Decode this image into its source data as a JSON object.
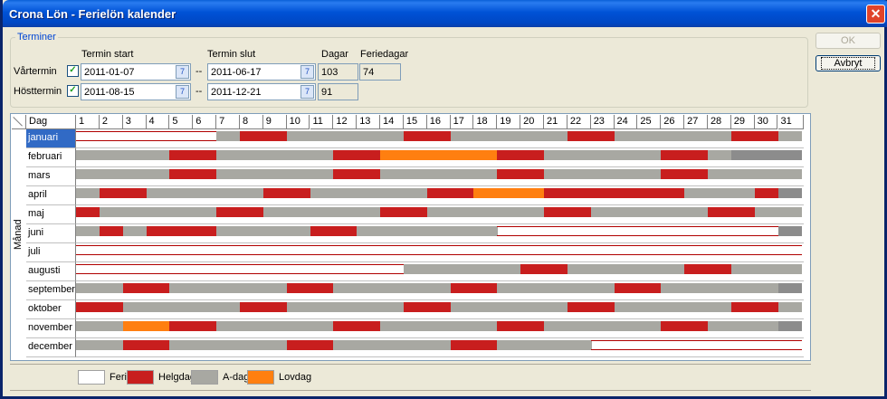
{
  "window": {
    "title": "Crona Lön - Ferielön kalender",
    "close_glyph": "✕"
  },
  "terminer": {
    "legend": "Terminer",
    "headers": {
      "start": "Termin start",
      "end": "Termin slut",
      "dagar": "Dagar",
      "feriedagar": "Feriedagar"
    },
    "spring": {
      "label": "Vårtermin",
      "checked": true,
      "start": "2011-01-07",
      "sep": "--",
      "end": "2011-06-17",
      "dagar": "103",
      "feriedagar": "74"
    },
    "autumn": {
      "label": "Hösttermin",
      "checked": true,
      "start": "2011-08-15",
      "sep": "--",
      "end": "2011-12-21",
      "dagar": "91",
      "feriedagar": ""
    }
  },
  "buttons": {
    "ok": "OK",
    "cancel": "Avbryt"
  },
  "calendar": {
    "day_header": "Dag",
    "axis_label": "Månad",
    "days": [
      "1",
      "2",
      "3",
      "4",
      "5",
      "6",
      "7",
      "8",
      "9",
      "10",
      "11",
      "12",
      "13",
      "14",
      "15",
      "16",
      "17",
      "18",
      "19",
      "20",
      "21",
      "22",
      "23",
      "24",
      "25",
      "26",
      "27",
      "28",
      "29",
      "30",
      "31"
    ],
    "colors": {
      "F": "#ffffff",
      "H": "#c81e1e",
      "A": "#a8a8a2",
      "L": "#ff7f10",
      "X": "#8c8c8c"
    },
    "months": [
      {
        "name": "januari",
        "pattern": "FFFFFFAHHAAAAAHHAAAAAHHAAAAAHHA"
      },
      {
        "name": "februari",
        "pattern": "AAAAHHAAAAAHHLLLLLHHAAAAAHHAXXX"
      },
      {
        "name": "mars",
        "pattern": "AAAAHHAAAAAHHAAAAAHHAAAAAHHAAAA"
      },
      {
        "name": "april",
        "pattern": "AHHAAAAAHHAAAAAHHLLLHHHHHHAAAHX"
      },
      {
        "name": "maj",
        "pattern": "HAAAAAHHAAAAAHHAAAAAHHAAAAAHHAA"
      },
      {
        "name": "juni",
        "pattern": "AHAHHHAAAAHHAAAAAAFFFFFFFFFFFFX"
      },
      {
        "name": "juli",
        "pattern": "FFFFFFFFFFFFFFFFFFFFFFFFFFFFFFF"
      },
      {
        "name": "augusti",
        "pattern": "FFFFFFFFFFFFFFAAAAAHHAAAAAHHAAA"
      },
      {
        "name": "september",
        "pattern": "AAHHAAAAAHHAAAAAHHAAAAAHHAAAAAX"
      },
      {
        "name": "oktober",
        "pattern": "HHAAAAAHHAAAAAHHAAAAAHHAAAAAHHA"
      },
      {
        "name": "november",
        "pattern": "AALLHHAAAAAHHAAAAAHHAAAAAHHAAAX"
      },
      {
        "name": "december",
        "pattern": "AAHHAAAAAHHAAAAAHHAAAAFFFFFFFFF"
      }
    ],
    "selected_month": "januari"
  },
  "legend": [
    {
      "key": "F",
      "label": "Ferie"
    },
    {
      "key": "H",
      "label": "Helgdag"
    },
    {
      "key": "A",
      "label": "A-dag"
    },
    {
      "key": "L",
      "label": "Lovdag"
    }
  ]
}
